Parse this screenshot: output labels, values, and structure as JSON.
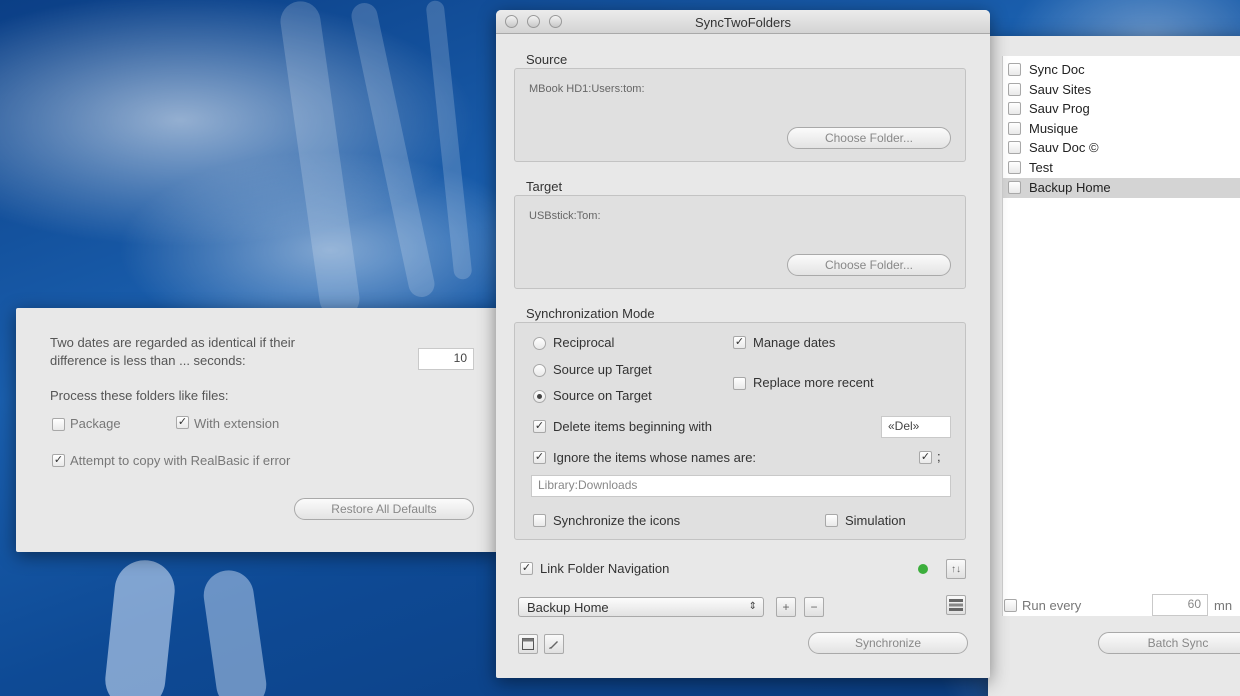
{
  "main_window": {
    "title": "SyncTwoFolders",
    "source": {
      "heading": "Source",
      "path": "MBook HD1:Users:tom:",
      "choose_label": "Choose Folder..."
    },
    "target": {
      "heading": "Target",
      "path": "USBstick:Tom:",
      "choose_label": "Choose Folder..."
    },
    "mode": {
      "heading": "Synchronization Mode",
      "reciprocal": "Reciprocal",
      "source_up_target": "Source up Target",
      "source_on_target": "Source on Target",
      "manage_dates": "Manage dates",
      "replace_more_recent": "Replace more recent",
      "delete_items": "Delete items beginning with",
      "delete_prefix": "«Del»",
      "ignore_items": "Ignore the items whose names are:",
      "ignore_semicolon": ";",
      "ignore_list": "Library:Downloads",
      "sync_icons": "Synchronize the icons",
      "simulation": "Simulation"
    },
    "link_folder_navigation": "Link Folder Navigation",
    "status_dot_color": "#3cae3c",
    "sort_symbol": "↑↓",
    "set_popup": "Backup Home",
    "add_symbol": "+",
    "remove_symbol": "−",
    "synchronize_label": "Synchronize"
  },
  "prefs_window": {
    "dates_text_line1": "Two dates are regarded as identical if their",
    "dates_text_line2": "difference is less than ... seconds:",
    "seconds_value": "10",
    "process_label": "Process these folders like files:",
    "package": "Package",
    "with_extension": "With extension",
    "attempt_copy": "Attempt to copy with RealBasic if error",
    "restore_defaults": "Restore All Defaults"
  },
  "batch_window": {
    "items": [
      {
        "label": "Sync Doc",
        "selected": false
      },
      {
        "label": "Sauv Sites",
        "selected": false
      },
      {
        "label": "Sauv Prog",
        "selected": false
      },
      {
        "label": "Musique",
        "selected": false
      },
      {
        "label": "Sauv Doc ©",
        "selected": false
      },
      {
        "label": "Test",
        "selected": false
      },
      {
        "label": "Backup Home",
        "selected": true
      }
    ],
    "run_every": "Run every",
    "run_value": "60",
    "run_unit": "mn",
    "batch_sync_label": "Batch Sync"
  }
}
